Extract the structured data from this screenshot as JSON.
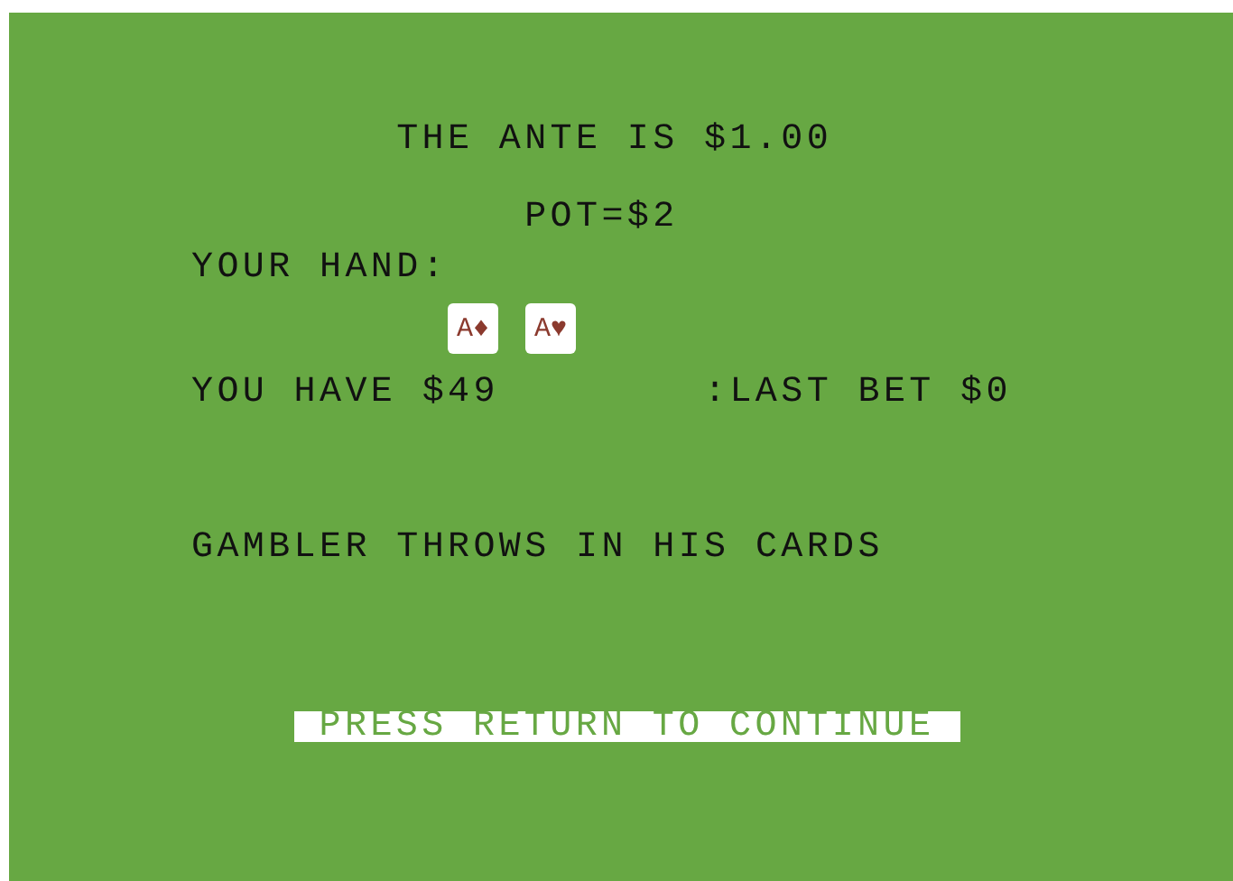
{
  "ante_line": "THE ANTE IS $1.00",
  "pot": "POT=$2",
  "hand_label": "YOUR HAND:",
  "cards": [
    {
      "rank": "A",
      "suit": "♦"
    },
    {
      "rank": "A",
      "suit": "♥"
    }
  ],
  "bankroll": "YOU HAVE $49",
  "last_bet": ":LAST BET $0",
  "message": "GAMBLER THROWS IN HIS CARDS",
  "prompt": "PRESS RETURN TO CONTINUE"
}
